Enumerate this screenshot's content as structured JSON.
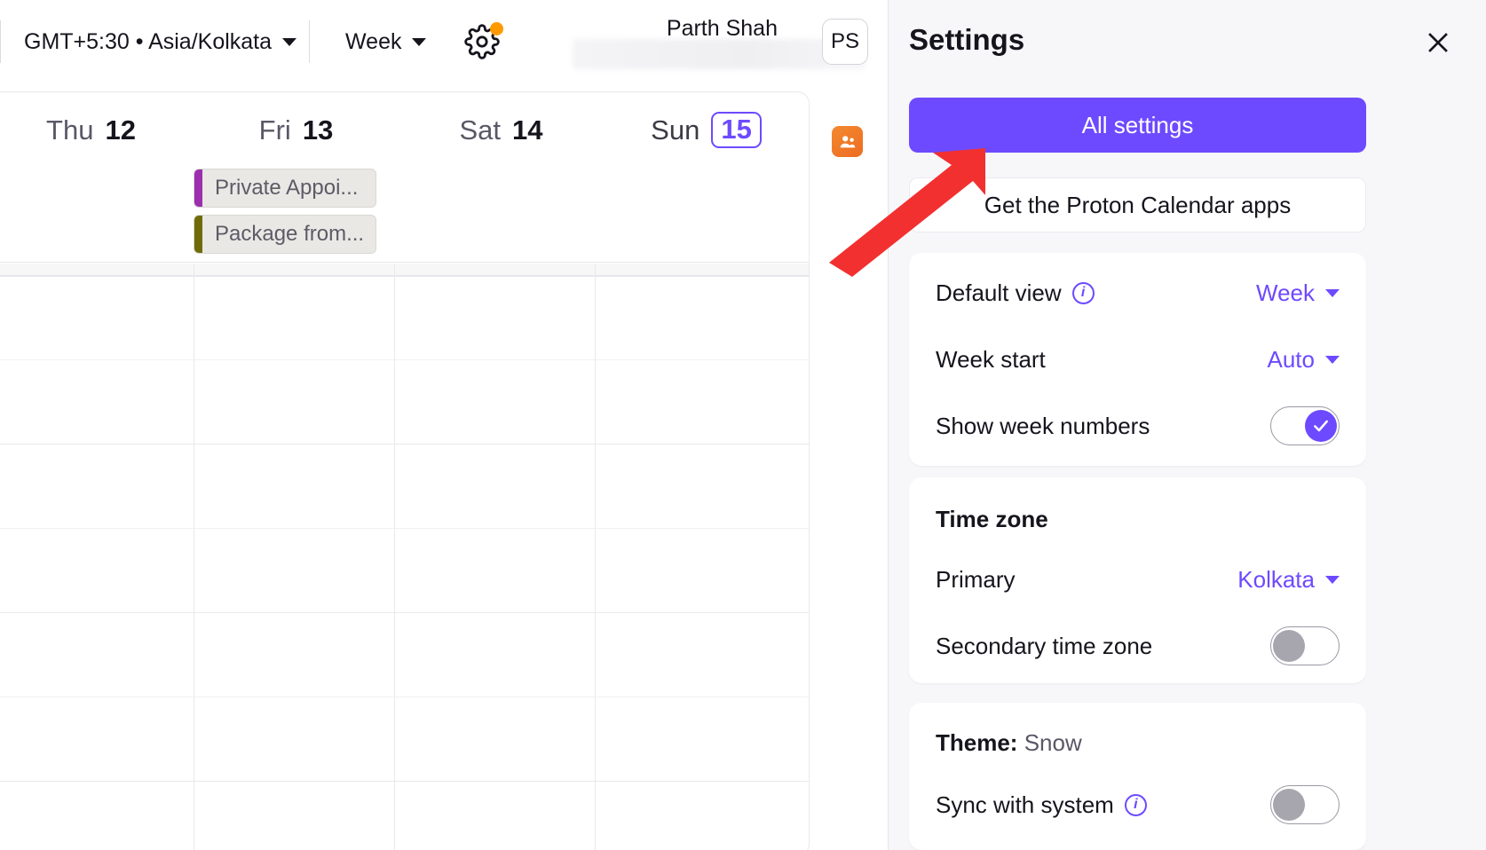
{
  "toolbar": {
    "timezone_label": "GMT+5:30 • Asia/Kolkata",
    "view_label": "Week",
    "gear_icon": "gear-icon",
    "notification_dot": "orange-dot",
    "user_name": "Parth Shah",
    "avatar_initials": "PS"
  },
  "calendar": {
    "days": [
      {
        "name": "Thu",
        "num": "12",
        "today": false
      },
      {
        "name": "Fri",
        "num": "13",
        "today": false
      },
      {
        "name": "Sat",
        "num": "14",
        "today": false
      },
      {
        "name": "Sun",
        "num": "15",
        "today": true
      }
    ],
    "events": [
      {
        "title": "Private Appoi...",
        "color": "#9b2fae",
        "day": 1,
        "slot": 0
      },
      {
        "title": "Package from...",
        "color": "#6e6b08",
        "day": 1,
        "slot": 1
      }
    ],
    "contacts_icon": "contacts-icon"
  },
  "drawer": {
    "title": "Settings",
    "close_icon": "close-icon",
    "all_settings_label": "All settings",
    "apps_label": "Get the Proton Calendar apps",
    "view_card": {
      "default_view_label": "Default view",
      "default_view_info_icon": "info-icon",
      "default_view_value": "Week",
      "week_start_label": "Week start",
      "week_start_value": "Auto",
      "show_week_numbers_label": "Show week numbers",
      "show_week_numbers_on": "on"
    },
    "timezone_card": {
      "title": "Time zone",
      "primary_label": "Primary",
      "primary_value": "Kolkata",
      "secondary_label": "Secondary time zone",
      "secondary_on": "off"
    },
    "theme_card": {
      "title_prefix": "Theme:",
      "title_value": "Snow",
      "sync_label": "Sync with system",
      "sync_info_icon": "info-icon",
      "sync_on": "off"
    }
  },
  "colors": {
    "accent": "#6d4aff",
    "annotation": "#f23030",
    "drawer_bg": "#f7f6f9"
  }
}
